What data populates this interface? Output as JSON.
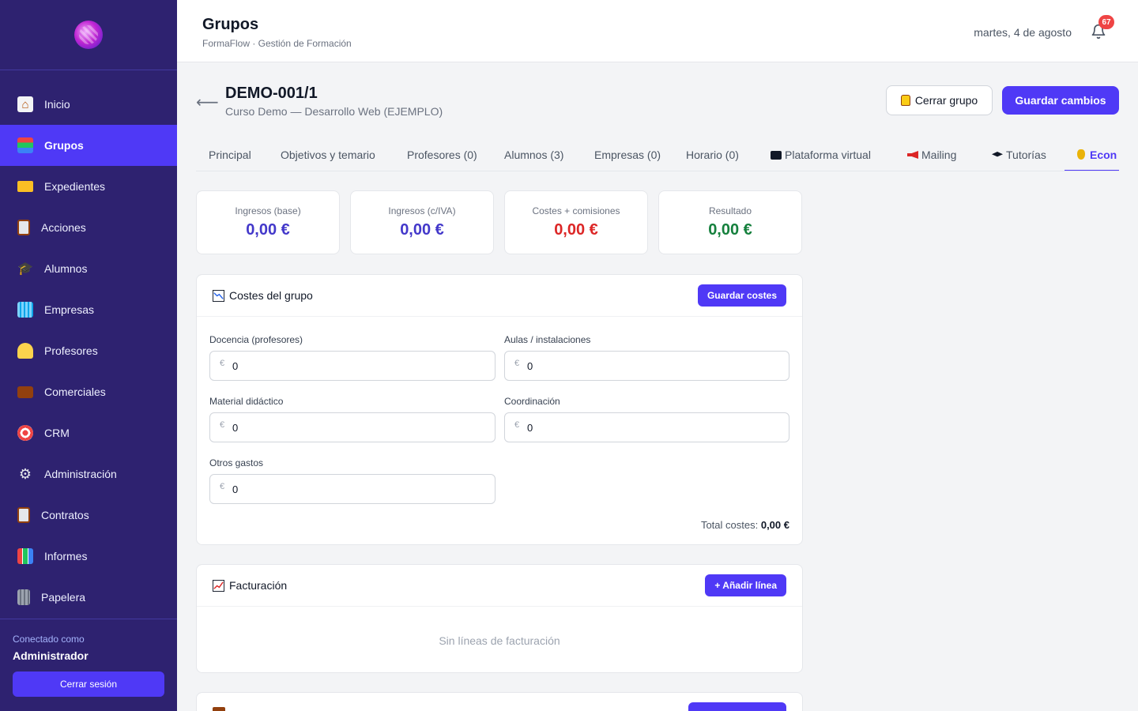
{
  "sidebar": {
    "items": [
      {
        "label": "Inicio",
        "icon": "home-icon",
        "active": false
      },
      {
        "label": "Grupos",
        "icon": "books-icon",
        "active": true
      },
      {
        "label": "Expedientes",
        "icon": "folder-icon",
        "active": false
      },
      {
        "label": "Acciones",
        "icon": "clipboard-icon",
        "active": false
      },
      {
        "label": "Alumnos",
        "icon": "graduation-cap-icon",
        "active": false
      },
      {
        "label": "Empresas",
        "icon": "building-icon",
        "active": false
      },
      {
        "label": "Profesores",
        "icon": "teacher-icon",
        "active": false
      },
      {
        "label": "Comerciales",
        "icon": "briefcase-icon",
        "active": false
      },
      {
        "label": "CRM",
        "icon": "target-icon",
        "active": false
      },
      {
        "label": "Administración",
        "icon": "gear-icon",
        "active": false
      },
      {
        "label": "Contratos",
        "icon": "clipboard-icon",
        "active": false
      },
      {
        "label": "Informes",
        "icon": "bar-chart-icon",
        "active": false
      },
      {
        "label": "Papelera",
        "icon": "trash-icon",
        "active": false
      }
    ],
    "connected_label": "Conectado como",
    "user": "Administrador",
    "logout_label": "Cerrar sesión"
  },
  "header": {
    "title": "Grupos",
    "subtitle": "FormaFlow · Gestión de Formación",
    "date": "martes, 4 de agosto",
    "notifications": "67"
  },
  "group": {
    "code": "DEMO-001/1",
    "course": "Curso Demo — Desarrollo Web (EJEMPLO)",
    "close_label": "Cerrar grupo",
    "save_label": "Guardar cambios"
  },
  "tabs": [
    {
      "label": "Principal",
      "icon": ""
    },
    {
      "label": "Objetivos y temario",
      "icon": ""
    },
    {
      "label": "Profesores (0)",
      "icon": ""
    },
    {
      "label": "Alumnos (3)",
      "icon": ""
    },
    {
      "label": "Empresas (0)",
      "icon": ""
    },
    {
      "label": "Horario (0)",
      "icon": ""
    },
    {
      "label": "Plataforma virtual",
      "icon": "computer-icon"
    },
    {
      "label": "Mailing",
      "icon": "megaphone-icon"
    },
    {
      "label": "Tutorías",
      "icon": "graduation-cap-icon"
    },
    {
      "label": "Econ",
      "icon": "money-bag-icon"
    }
  ],
  "stats": [
    {
      "label": "Ingresos (base)",
      "value": "0,00 €",
      "color": "#4338ca"
    },
    {
      "label": "Ingresos (c/IVA)",
      "value": "0,00 €",
      "color": "#4338ca"
    },
    {
      "label": "Costes + comisiones",
      "value": "0,00 €",
      "color": "#dc2626"
    },
    {
      "label": "Resultado",
      "value": "0,00 €",
      "color": "#15803d"
    }
  ],
  "costs": {
    "title": "Costes del grupo",
    "save_label": "Guardar costes",
    "currency": "€",
    "fields": [
      {
        "label": "Docencia (profesores)",
        "value": "0"
      },
      {
        "label": "Aulas / instalaciones",
        "value": "0"
      },
      {
        "label": "Material didáctico",
        "value": "0"
      },
      {
        "label": "Coordinación",
        "value": "0"
      },
      {
        "label": "Otros gastos",
        "value": "0"
      }
    ],
    "total_label": "Total costes:",
    "total_value": "0,00 €"
  },
  "billing": {
    "title": "Facturación",
    "add_label": "+ Añadir línea",
    "empty": "Sin líneas de facturación"
  }
}
